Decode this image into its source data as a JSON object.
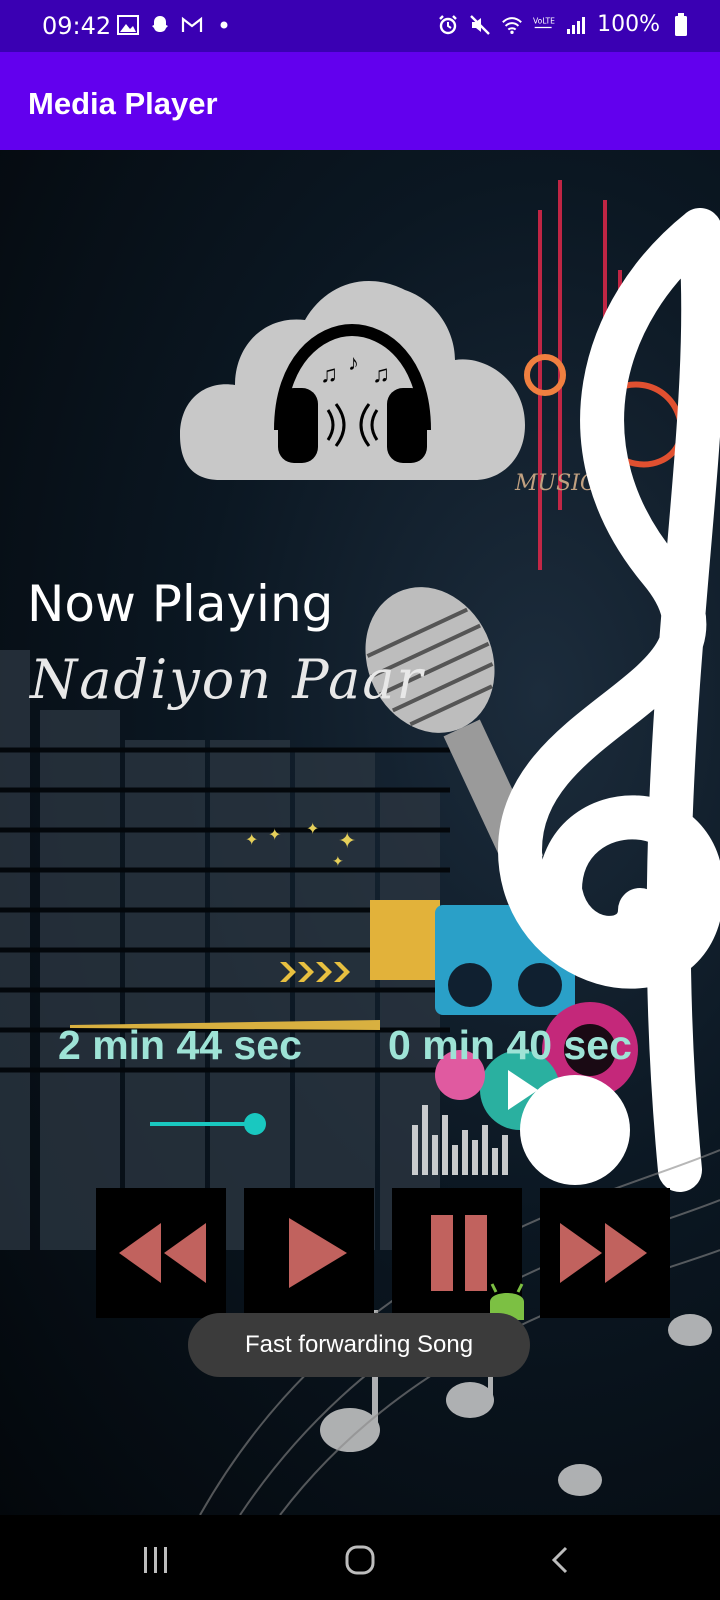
{
  "status_bar": {
    "time": "09:42",
    "battery": "100%",
    "left_icons": [
      "gallery-icon",
      "snapchat-icon",
      "gmail-icon",
      "dot-icon"
    ],
    "right_icons": [
      "alarm-icon",
      "mute-icon",
      "wifi-icon",
      "volte-icon",
      "signal-icon",
      "battery-icon"
    ]
  },
  "app_bar": {
    "title": "Media Player"
  },
  "player": {
    "now_playing_label": "Now Playing",
    "song_title": "Nadiyon Paar",
    "elapsed_time": "2 min 44 sec",
    "remaining_time": "0 min 40 sec",
    "seek_progress": 0.75
  },
  "controls": {
    "rewind": "rewind-icon",
    "play": "play-icon",
    "pause": "pause-icon",
    "fast_forward": "fast-forward-icon",
    "color": "#c1625e"
  },
  "background": {
    "watermark": "MUSIC"
  },
  "toast": {
    "message": "Fast forwarding Song"
  },
  "nav_bar": {
    "buttons": [
      "recents-icon",
      "home-icon",
      "back-icon"
    ]
  },
  "colors": {
    "status_bar": "#3a00b3",
    "app_bar": "#6200ee",
    "accent": "#19c8c0",
    "time_text": "#9ee3d6"
  }
}
